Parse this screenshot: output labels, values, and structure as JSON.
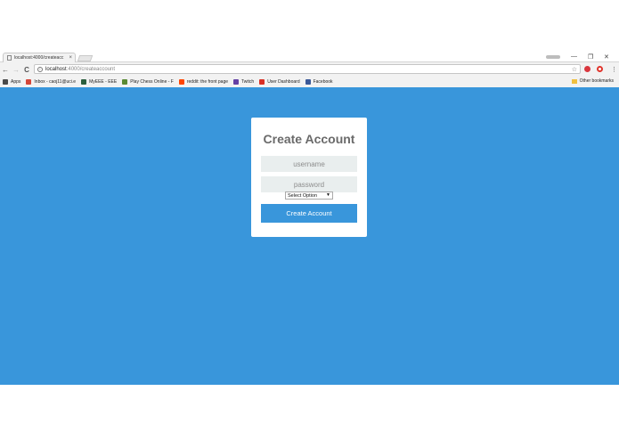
{
  "browser": {
    "tab_title": "localhost:4000/createacc",
    "tab_close": "×",
    "url_host": "localhost",
    "url_path": ":4000/createaccount",
    "nav_back": "←",
    "nav_forward": "→",
    "nav_reload": "C",
    "star": "☆",
    "window_minimize": "—",
    "window_restore": "❐",
    "window_close": "✕",
    "menu": "⋮",
    "bookmarks": [
      {
        "label": "Apps",
        "icon": "apps-grid-icon",
        "color": "#4a4a4a"
      },
      {
        "label": "Inbox - caoj11@uci.e",
        "icon": "gmail-icon",
        "color": "#d44638"
      },
      {
        "label": "MyEEE - EEE",
        "icon": "eee-icon",
        "color": "#2b5f3e"
      },
      {
        "label": "Play Chess Online - F",
        "icon": "chess-icon",
        "color": "#5b8a33"
      },
      {
        "label": "reddit: the front page",
        "icon": "reddit-icon",
        "color": "#ff4500"
      },
      {
        "label": "Twitch",
        "icon": "twitch-icon",
        "color": "#6441a5"
      },
      {
        "label": "User Dashboard",
        "icon": "dashboard-icon",
        "color": "#d93025"
      },
      {
        "label": "Facebook",
        "icon": "facebook-icon",
        "color": "#3b5998"
      }
    ],
    "other_bookmarks": "Other bookmarks"
  },
  "form": {
    "title": "Create Account",
    "username_placeholder": "username",
    "password_placeholder": "password",
    "select_value": "Select Option",
    "select_arrow": "▼",
    "submit_label": "Create Account"
  },
  "colors": {
    "background_blue": "#3996db",
    "button_blue": "#3996db",
    "input_bg": "#e9eeee"
  }
}
